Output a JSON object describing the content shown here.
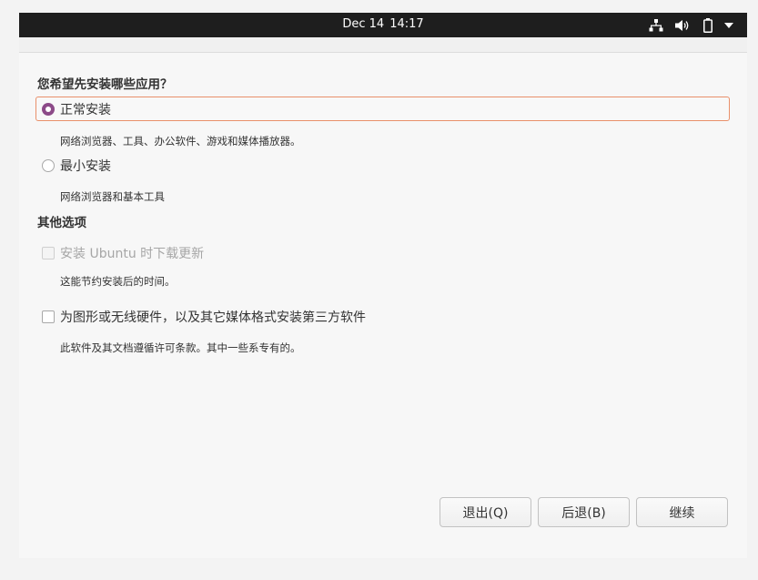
{
  "topbar": {
    "date": "Dec 14",
    "time": "14:17",
    "icons": [
      "network-wired-icon",
      "volume-icon",
      "battery-icon",
      "system-menu-arrow-icon"
    ]
  },
  "installer": {
    "question": "您希望先安装哪些应用？",
    "normal_install": {
      "label": "正常安装",
      "description": "网络浏览器、工具、办公软件、游戏和媒体播放器。",
      "selected": true
    },
    "minimal_install": {
      "label": "最小安装",
      "description": "网络浏览器和基本工具",
      "selected": false
    },
    "other_options_title": "其他选项",
    "download_updates": {
      "label": "安装 Ubuntu 时下载更新",
      "description": "这能节约安装后的时间。",
      "checked": false,
      "enabled": false
    },
    "third_party": {
      "label": "为图形或无线硬件，以及其它媒体格式安装第三方软件",
      "description": "此软件及其文档遵循许可条款。其中一些系专有的。",
      "checked": false,
      "enabled": true
    }
  },
  "buttons": {
    "quit": "退出(Q)",
    "back": "后退(B)",
    "continue": "继续"
  },
  "colors": {
    "accent": "#8c4a88",
    "focus": "#e9906a",
    "topbar": "#1e1e1e"
  }
}
